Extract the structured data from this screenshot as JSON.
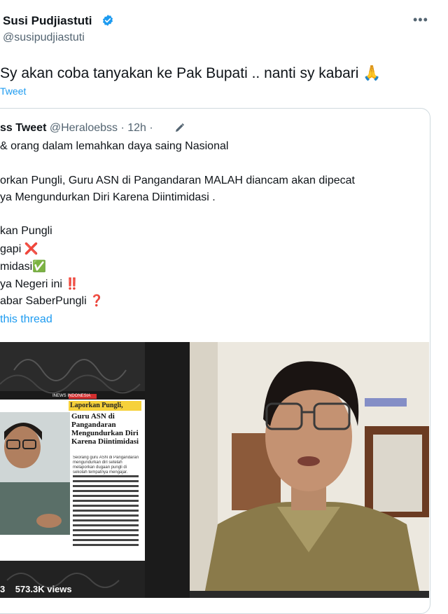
{
  "author": {
    "name": "Susi Pudjiastuti",
    "handle": "@susipudjiastuti",
    "verified_color": "#1d9bf0"
  },
  "tweet": {
    "text": "Sy akan coba tanyakan ke Pak Bupati .. nanti sy kabari 🙏",
    "translate_label": "Tweet"
  },
  "quote": {
    "name": "ss Tweet",
    "handle": "@Heraloebss",
    "time": "· 12h ·",
    "lines": [
      "& orang dalam lemahkan daya saing Nasional",
      "",
      "orkan Pungli, Guru ASN di Pangandaran MALAH diancam akan dipecat",
      "ya Mengundurkan Diri Karena Diintimidasi .",
      "",
      "kan Pungli",
      "gapi ❌",
      "midasi✅",
      "ya Negeri ini ‼️",
      "abar SaberPungli ❓"
    ],
    "show_thread": "this thread"
  },
  "media": {
    "inner_post": {
      "source_badge": "INEWS INDONESIA",
      "headline_1": "Laporkan Pungli,",
      "headline_2": "Guru ASN di Pangandaran Mengundurkan Diri Karena Diintimidasi",
      "caption": "Seorang guru ASN di Pangandaran mengundurkan diri setelah melaporkan dugaan pungli di sekolah tempatnya mengajar."
    },
    "views": "573.3K views",
    "views_prefix": "3"
  },
  "icons": {
    "more": "more-dots-icon",
    "verified": "verified-badge-icon",
    "edit": "edited-pencil-icon"
  }
}
